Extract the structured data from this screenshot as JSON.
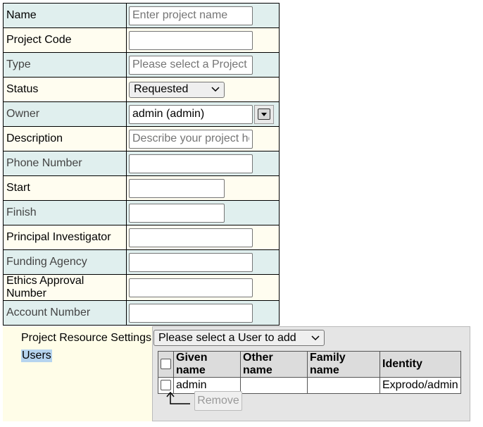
{
  "form": {
    "rows": [
      {
        "label": "Name",
        "placeholder": "Enter project name",
        "value": ""
      },
      {
        "label": "Project Code",
        "value": ""
      },
      {
        "label": "Type",
        "placeholder": "Please select a Project Type",
        "value": ""
      },
      {
        "label": "Status",
        "selected": "Requested"
      },
      {
        "label": "Owner",
        "value": "admin (admin)"
      },
      {
        "label": "Description",
        "placeholder": "Describe your project here",
        "value": ""
      },
      {
        "label": "Phone Number",
        "value": ""
      },
      {
        "label": "Start",
        "value": ""
      },
      {
        "label": "Finish",
        "value": ""
      },
      {
        "label": "Principal Investigator",
        "value": ""
      },
      {
        "label": "Funding Agency",
        "value": ""
      },
      {
        "label": "Ethics Approval Number",
        "value": ""
      },
      {
        "label": "Account Number",
        "value": ""
      }
    ]
  },
  "resources": {
    "settings_label": "Project Resource Settings",
    "users_label": "Users",
    "user_select": "Please select a User to add",
    "columns": [
      "Given name",
      "Other name",
      "Family name",
      "Identity"
    ],
    "rows": [
      {
        "given": "admin",
        "other": "",
        "family": "",
        "identity": "Exprodo/admin"
      }
    ],
    "remove_label": "Remove"
  }
}
